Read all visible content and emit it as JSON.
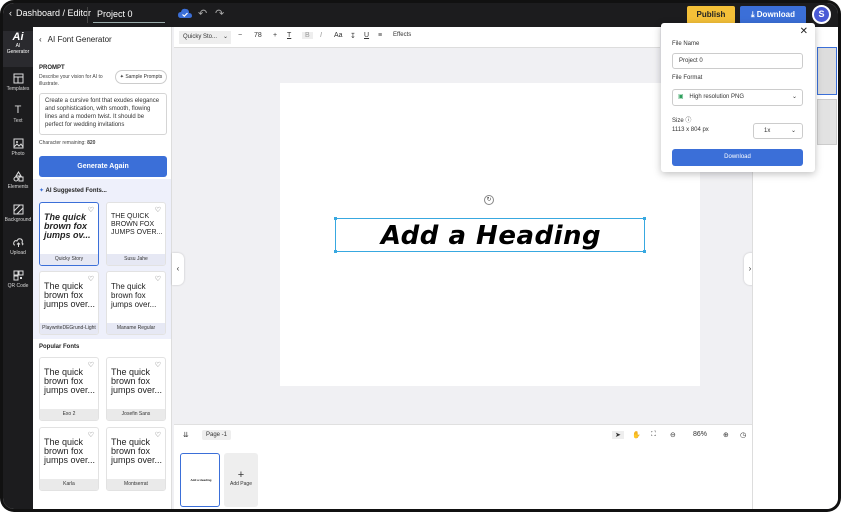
{
  "topbar": {
    "breadcrumb": "Dashboard / Editor",
    "project_name": "Project 0",
    "publish_label": "Publish",
    "download_label": "Download",
    "avatar_initial": "S"
  },
  "rail": {
    "items": [
      {
        "label": "AI Generator",
        "icon": "ai-icon"
      },
      {
        "label": "Templates",
        "icon": "templates-icon"
      },
      {
        "label": "Text",
        "icon": "text-icon"
      },
      {
        "label": "Photo",
        "icon": "photo-icon"
      },
      {
        "label": "Elements",
        "icon": "elements-icon"
      },
      {
        "label": "Background",
        "icon": "background-icon"
      },
      {
        "label": "Upload",
        "icon": "upload-icon"
      },
      {
        "label": "QR Code",
        "icon": "qr-code-icon"
      }
    ]
  },
  "panel": {
    "title": "AI Font Generator",
    "prompt_label": "PROMPT",
    "prompt_desc": "Describe your vision for AI to illustrate.",
    "sample_prompts": "Sample Prompts",
    "prompt_text": "Create a cursive font that exudes elegance and sophistication, with smooth, flowing lines and a modern twist. It should be perfect for wedding invitations",
    "char_remaining_label": "Character remaining:",
    "char_remaining_value": "820",
    "generate_label": "Generate Again",
    "ai_fonts_title": "AI Suggested Fonts...",
    "ai_fonts": [
      {
        "preview": "The quick brown fox jumps ov...",
        "name": "Quicky Story"
      },
      {
        "preview": "THE QUICK BROWN FOX JUMPS OVER...",
        "name": "Susu Jahe"
      },
      {
        "preview": "The quick brown fox jumps over...",
        "name": "PlaywriteDEGrund-Light"
      },
      {
        "preview": "The quick brown fox jumps over...",
        "name": "Maname Regular"
      }
    ],
    "popular_title": "Popular Fonts",
    "popular_fonts": [
      {
        "preview": "The quick brown fox jumps over...",
        "name": "Exo 2"
      },
      {
        "preview": "The quick brown fox jumps over...",
        "name": "Josefin Sans"
      },
      {
        "preview": "The quick brown fox jumps over...",
        "name": "Karla"
      },
      {
        "preview": "The quick brown fox jumps over...",
        "name": "Montserrat"
      }
    ]
  },
  "formatbar": {
    "font_name": "Quicky Sto...",
    "font_size": "78",
    "minus": "−",
    "plus": "+",
    "bold": "B",
    "italic": "I",
    "case": "Aa",
    "underline": "U",
    "effects": "Effects"
  },
  "canvas": {
    "heading_text": "Add a Heading",
    "rotate_glyph": "↻"
  },
  "bottombar": {
    "page_label": "Page -1",
    "zoom": "86%"
  },
  "thumbs": {
    "thumb_text": "Add a Heading",
    "add_page_label": "Add Page"
  },
  "popover": {
    "file_name_label": "File Name",
    "file_name_value": "Project 0",
    "file_format_label": "File Format",
    "file_format_value": "High resolution PNG",
    "size_label": "Size",
    "size_value": "1113 x 804 px",
    "scale_value": "1x",
    "download_label": "Download"
  },
  "colors": {
    "accent": "#3b6fd8",
    "publish": "#f4c038",
    "topbar": "#1c1c1e"
  }
}
